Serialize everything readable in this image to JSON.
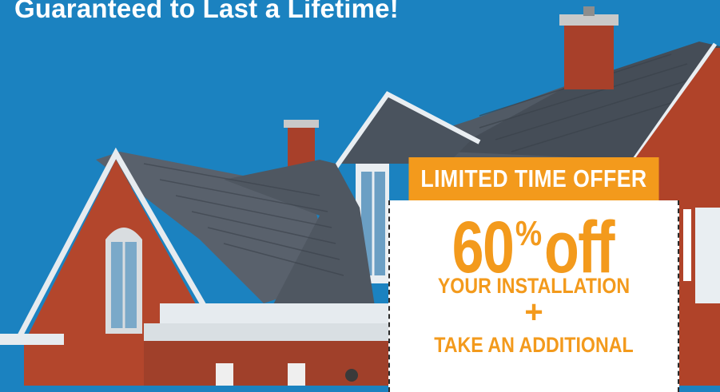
{
  "headline": "Guaranteed to Last a Lifetime!",
  "offer": {
    "header": "LIMITED TIME OFFER",
    "discount_number": "60",
    "discount_percent": "%",
    "discount_word": "off",
    "line_installation": "YOUR INSTALLATION",
    "plus": "+",
    "line_additional": "TAKE AN ADDITIONAL"
  },
  "colors": {
    "sky": "#1b82c0",
    "accent_orange": "#f39a1c",
    "brick": "#b4482e",
    "roof": "#4d5560"
  }
}
